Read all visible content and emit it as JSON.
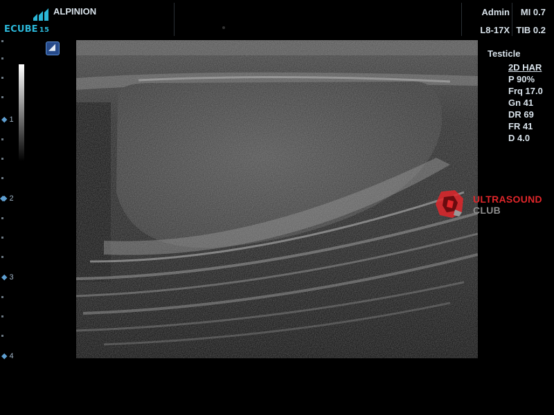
{
  "header": {
    "logo_text": "ECUBE",
    "logo_num": "15",
    "brand": "ALPINION",
    "user": "Admin",
    "mi": "MI 0.7",
    "probe": "L8-17X",
    "tib": "TIB 0.2"
  },
  "depth_scale": {
    "labels": [
      "1",
      "2",
      "3",
      "4"
    ]
  },
  "params": {
    "preset": "Testicle",
    "mode": "2D HAR",
    "power": "P 90%",
    "frequency": "Frq 17.0",
    "gain": "Gn 41",
    "dynamic_range": "DR 69",
    "frame_rate": "FR 41",
    "depth": "D 4.0"
  },
  "watermark": {
    "line1": "ULTRASOUND",
    "line2": "CLUB",
    "color_primary": "#e0262a",
    "color_secondary": "#8e8e8e"
  },
  "colors": {
    "accent": "#2bb7d8",
    "text": "#d8e2ea"
  }
}
